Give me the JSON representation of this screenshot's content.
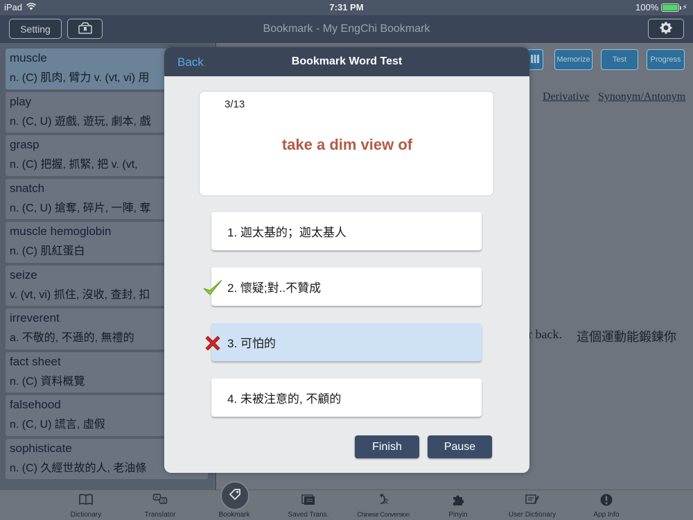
{
  "status": {
    "device": "iPad",
    "time": "7:31 PM",
    "battery": "100%",
    "battery_level": 1.0
  },
  "nav": {
    "setting_label": "Setting",
    "title": "Bookmark - My EngChi Bookmark",
    "icons": [
      "bookmark-box-icon",
      "gear-icon"
    ]
  },
  "list": [
    {
      "word": "muscle",
      "def": "n. (C) 肌肉, 臂力  v. (vt, vi) 用"
    },
    {
      "word": "play",
      "def": "n. (C, U) 遊戲, 遊玩, 劇本, 戲"
    },
    {
      "word": "grasp",
      "def": "n. (C) 把握, 抓緊, 把  v. (vt,"
    },
    {
      "word": "snatch",
      "def": "n. (C, U) 搶奪, 碎片, 一陣, 奪"
    },
    {
      "word": "muscle hemoglobin",
      "def": "n. (C) 肌紅蛋白"
    },
    {
      "word": "seize",
      "def": "v. (vt, vi) 抓住, 沒收, 查封, 扣"
    },
    {
      "word": "irreverent",
      "def": "a. 不敬的, 不遜的, 無禮的"
    },
    {
      "word": "fact sheet",
      "def": "n. (C) 資料概覽"
    },
    {
      "word": "falsehood",
      "def": "n. (C, U) 謊言, 虛假"
    },
    {
      "word": "sophisticate",
      "def": "n. (C) 久經世故的人, 老油條"
    }
  ],
  "right": {
    "buttons": {
      "memorize": "Memorize",
      "test": "Test",
      "progress": "Progress"
    },
    "links": {
      "derivative": "Derivative",
      "synonym": "Synonym/Antonym"
    },
    "text_en": "r back.",
    "text_zh": "這個運動能鍛鍊你"
  },
  "modal": {
    "back": "Back",
    "title": "Bookmark Word Test",
    "progress": "3/13",
    "word": "take a dim view of",
    "word_color": "#b35a45",
    "options": [
      {
        "label": "1. 迦太基的；迦太基人",
        "mark": ""
      },
      {
        "label": "2. 懷疑;對..不贊成",
        "mark": "check-icon"
      },
      {
        "label": "3. 可怕的",
        "mark": "cross-icon"
      },
      {
        "label": "4. 未被注意的, 不顧的",
        "mark": ""
      }
    ],
    "finish": "Finish",
    "pause": "Pause"
  },
  "tabs": [
    {
      "label": "Dictionary",
      "icon": "book-icon"
    },
    {
      "label": "Translator",
      "icon": "translate-icon"
    },
    {
      "label": "Bookmark",
      "icon": "tag-icon"
    },
    {
      "label": "Saved Trans.",
      "icon": "saved-icon"
    },
    {
      "label": "Chinese Conversion",
      "icon": "conversion-icon"
    },
    {
      "label": "Pinyin",
      "icon": "puzzle-icon"
    },
    {
      "label": "User Dictionary",
      "icon": "user-dict-icon"
    },
    {
      "label": "App Info",
      "icon": "info-icon"
    }
  ]
}
